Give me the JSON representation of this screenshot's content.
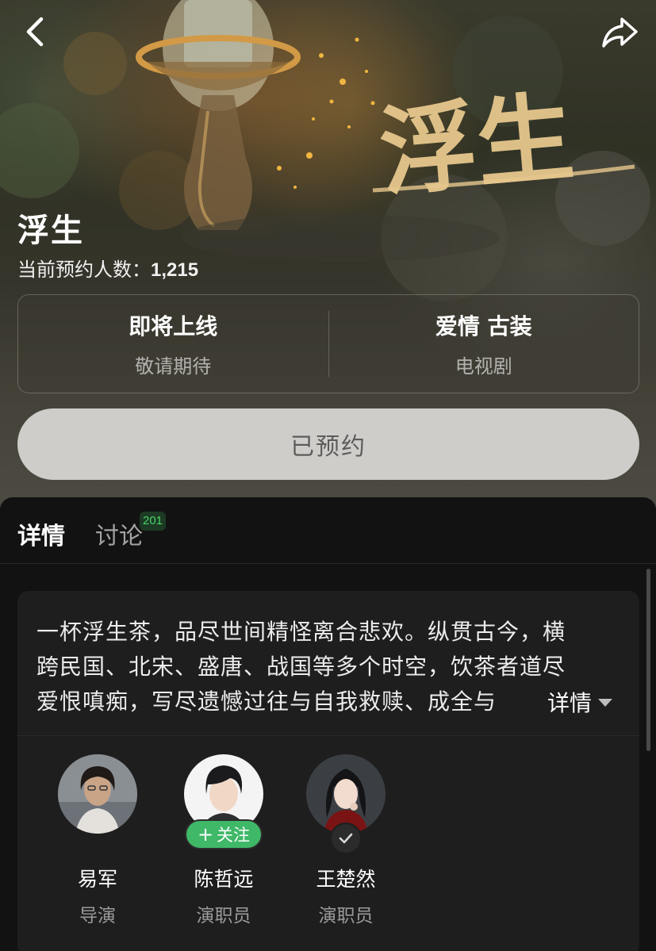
{
  "nav": {
    "back_icon": "chevron-left-icon",
    "share_icon": "share-arrow-icon"
  },
  "poster": {
    "calligraphy": "浮生"
  },
  "show": {
    "title": "浮生",
    "subscribe_label": "当前预约人数：",
    "subscribe_count": "1,215"
  },
  "info": {
    "status": "即将上线",
    "status_sub": "敬请期待",
    "genres": "爱情 古装",
    "category": "电视剧"
  },
  "reserve_button": "已预约",
  "tabs": {
    "details": "详情",
    "discussion": "讨论",
    "discussion_count": "201"
  },
  "synopsis": {
    "lines": [
      "一杯浮生茶，品尽世间精怪离合悲欢。纵贯古今，横",
      "跨民国、北宋、盛唐、战国等多个时空，饮茶者道尽",
      "爱恨嗔痴，写尽遗憾过往与自我救赎、成全与"
    ],
    "expand_label": "详情"
  },
  "cast": [
    {
      "name": "易军",
      "role": "导演"
    },
    {
      "name": "陈哲远",
      "role": "演职员",
      "follow_label": "关注",
      "follow_icon": "plus-icon"
    },
    {
      "name": "王楚然",
      "role": "演职员",
      "followed_icon": "check-icon"
    }
  ],
  "colors": {
    "accent_green": "#3fb868",
    "badge_green": "#46d36a",
    "reserve_button_bg": "#cfcdca",
    "sheet_bg": "#121212",
    "card_bg": "#1e1e1e"
  }
}
